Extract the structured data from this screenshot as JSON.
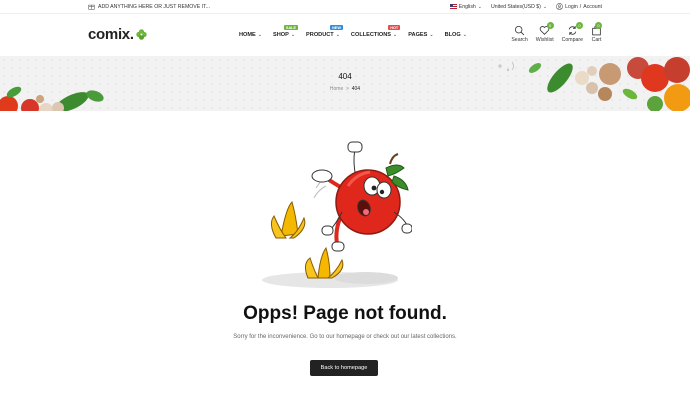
{
  "topbar": {
    "promo_text": "ADD ANYTHING HERE OR JUST REMOVE IT...",
    "language": "English",
    "currency": "United States(USD $)",
    "login_label": "Login",
    "separator": "/",
    "account_label": "Account"
  },
  "header": {
    "logo_text": "comix.",
    "nav": [
      {
        "label": "HOME",
        "badge": ""
      },
      {
        "label": "SHOP",
        "badge": "SALE",
        "badge_color": "#6cb63b"
      },
      {
        "label": "PRODUCT",
        "badge": "NEW",
        "badge_color": "#2f8ee0"
      },
      {
        "label": "COLLECTIONS",
        "badge": "HOT",
        "badge_color": "#e84b4b"
      },
      {
        "label": "PAGES",
        "badge": ""
      },
      {
        "label": "BLOG",
        "badge": ""
      }
    ],
    "icons": {
      "search_label": "Search",
      "wishlist_label": "Wishlist",
      "wishlist_count": "0",
      "compare_label": "Compare",
      "compare_count": "0",
      "cart_label": "Cart",
      "cart_count": "0"
    },
    "accent_color": "#6cb63b"
  },
  "banner": {
    "title": "404",
    "crumb_home": "Home",
    "crumb_sep": ">",
    "crumb_current": "404"
  },
  "main": {
    "title": "Opps! Page not found.",
    "subtitle": "Sorry for the inconvenience. Go to our homepage or check out our latest collections.",
    "button_label": "Back to homepage"
  }
}
